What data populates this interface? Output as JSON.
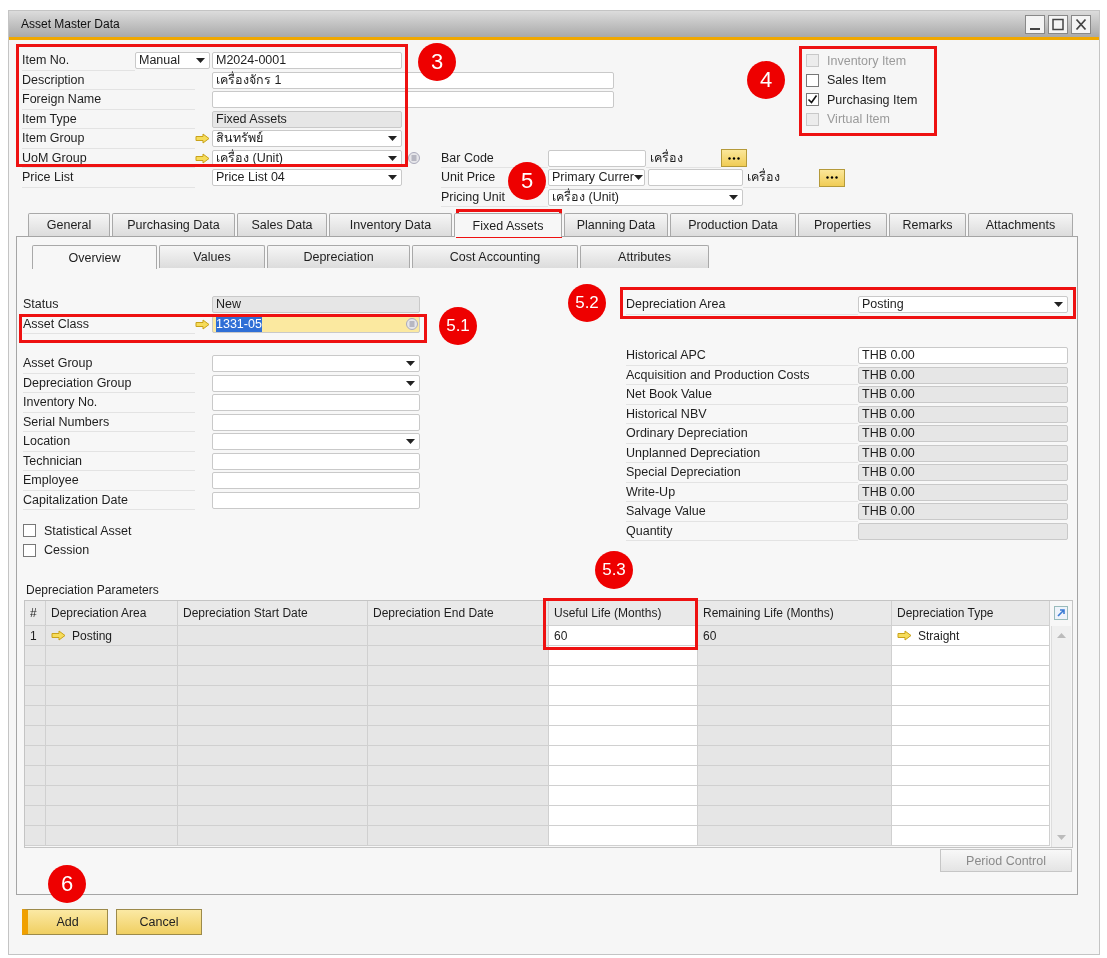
{
  "window": {
    "title": "Asset Master Data"
  },
  "header_fields": [
    {
      "kind": "series",
      "label": "Item No.",
      "series": "Manual",
      "value": "M2024-0001",
      "details_button": false
    },
    {
      "kind": "wide_text",
      "label": "Description",
      "value": "เครื่องจักร 1",
      "details_button": false
    },
    {
      "kind": "wide_text",
      "label": "Foreign Name",
      "details_button": false
    },
    {
      "kind": "readonly",
      "label": "Item Type",
      "value": "Fixed Assets",
      "details_button": false
    },
    {
      "kind": "link_dropdown",
      "label": "Item Group",
      "value": "สินทรัพย์",
      "details_button": false
    },
    {
      "kind": "link_dropdown",
      "label": "UoM Group",
      "value": "เครื่อง (Unit)",
      "details_button": true
    },
    {
      "kind": "dropdown",
      "label": "Price List",
      "value": "Price List 04",
      "details_button": false
    }
  ],
  "item_types": [
    {
      "label": "Inventory Item",
      "checked": false,
      "disabled": true
    },
    {
      "label": "Sales Item",
      "checked": false,
      "disabled": false
    },
    {
      "label": "Purchasing Item",
      "checked": true,
      "disabled": false
    },
    {
      "label": "Virtual Item",
      "checked": false,
      "disabled": true
    }
  ],
  "price_fields": [
    {
      "kind": "field_unit",
      "label": "Bar Code",
      "unit": "เครื่อง"
    },
    {
      "kind": "currency_unit",
      "label": "Unit Price",
      "currency": "Primary Currer",
      "unit": "เครื่อง"
    },
    {
      "kind": "dropdown",
      "label": "Pricing Unit",
      "value": "เครื่อง (Unit)"
    }
  ],
  "tabs": [
    {
      "label": "General",
      "selected": false
    },
    {
      "label": "Purchasing Data",
      "selected": false
    },
    {
      "label": "Sales Data",
      "selected": false
    },
    {
      "label": "Inventory Data",
      "selected": false
    },
    {
      "label": "Fixed Assets",
      "selected": true
    },
    {
      "label": "Planning Data",
      "selected": false
    },
    {
      "label": "Production Data",
      "selected": false
    },
    {
      "label": "Properties",
      "selected": false
    },
    {
      "label": "Remarks",
      "selected": false
    },
    {
      "label": "Attachments",
      "selected": false
    }
  ],
  "subtabs": [
    {
      "label": "Overview",
      "selected": true
    },
    {
      "label": "Values",
      "selected": false
    },
    {
      "label": "Depreciation",
      "selected": false
    },
    {
      "label": "Cost Accounting",
      "selected": false
    },
    {
      "label": "Attributes",
      "selected": false
    }
  ],
  "overview": {
    "sections": [
      [
        {
          "kind": "readonly",
          "label": "Status",
          "value": "New",
          "focused": false
        },
        {
          "kind": "link_text",
          "label": "Asset Class",
          "value": "1331-05",
          "focused": true
        }
      ],
      [
        {
          "kind": "dropdown",
          "label": "Asset Group",
          "focused": false
        },
        {
          "kind": "dropdown",
          "label": "Depreciation Group",
          "focused": false
        },
        {
          "kind": "text",
          "label": "Inventory No.",
          "focused": false
        },
        {
          "kind": "text",
          "label": "Serial Numbers",
          "focused": false
        },
        {
          "kind": "dropdown",
          "label": "Location",
          "focused": false
        },
        {
          "kind": "text",
          "label": "Technician",
          "focused": false
        },
        {
          "kind": "text",
          "label": "Employee",
          "focused": false
        },
        {
          "kind": "text",
          "label": "Capitalization Date",
          "focused": false
        }
      ]
    ],
    "flags": [
      {
        "label": "Statistical Asset",
        "checked": false
      },
      {
        "label": "Cession",
        "checked": false
      }
    ],
    "depreciation_area": {
      "label": "Depreciation Area",
      "value": "Posting"
    },
    "values": [
      {
        "label": "Historical APC",
        "value": "THB 0.00",
        "editable": true
      },
      {
        "label": "Acquisition and Production Costs",
        "value": "THB 0.00",
        "editable": false
      },
      {
        "label": "Net Book Value",
        "value": "THB 0.00",
        "editable": false
      },
      {
        "label": "Historical NBV",
        "value": "THB 0.00",
        "editable": false
      },
      {
        "label": "Ordinary Depreciation",
        "value": "THB 0.00",
        "editable": false
      },
      {
        "label": "Unplanned Depreciation",
        "value": "THB 0.00",
        "editable": false
      },
      {
        "label": "Special Depreciation",
        "value": "THB 0.00",
        "editable": false
      },
      {
        "label": "Write-Up",
        "value": "THB 0.00",
        "editable": false
      },
      {
        "label": "Salvage Value",
        "value": "THB 0.00",
        "editable": false
      },
      {
        "label": "Quantity",
        "editable": false
      }
    ]
  },
  "depreciation_parameters": {
    "title": "Depreciation Parameters",
    "columns": [
      {
        "label": "#",
        "editable": false
      },
      {
        "label": "Depreciation Area",
        "editable": false
      },
      {
        "label": "Depreciation Start Date",
        "editable": false
      },
      {
        "label": "Depreciation End Date",
        "editable": false
      },
      {
        "label": "Useful Life (Months)",
        "editable": true
      },
      {
        "label": "Remaining Life (Months)",
        "editable": false
      },
      {
        "label": "Depreciation Type",
        "editable": true
      }
    ],
    "rows": [
      {
        "cells": [
          {
            "text": "1"
          },
          {
            "text": "Posting",
            "link": true
          },
          {},
          {},
          {
            "text": "60"
          },
          {
            "text": "60"
          },
          {
            "text": "Straight",
            "link": true
          }
        ]
      }
    ]
  },
  "period_control": {
    "label": "Period Control",
    "disabled": true
  },
  "buttons": [
    {
      "label": "Add",
      "primary": true
    },
    {
      "label": "Cancel",
      "primary": false
    }
  ],
  "annotations": [
    {
      "number": "3"
    },
    {
      "number": "4"
    },
    {
      "number": "5"
    },
    {
      "number": "5.1"
    },
    {
      "number": "5.2"
    },
    {
      "number": "5.3"
    },
    {
      "number": "6"
    }
  ]
}
